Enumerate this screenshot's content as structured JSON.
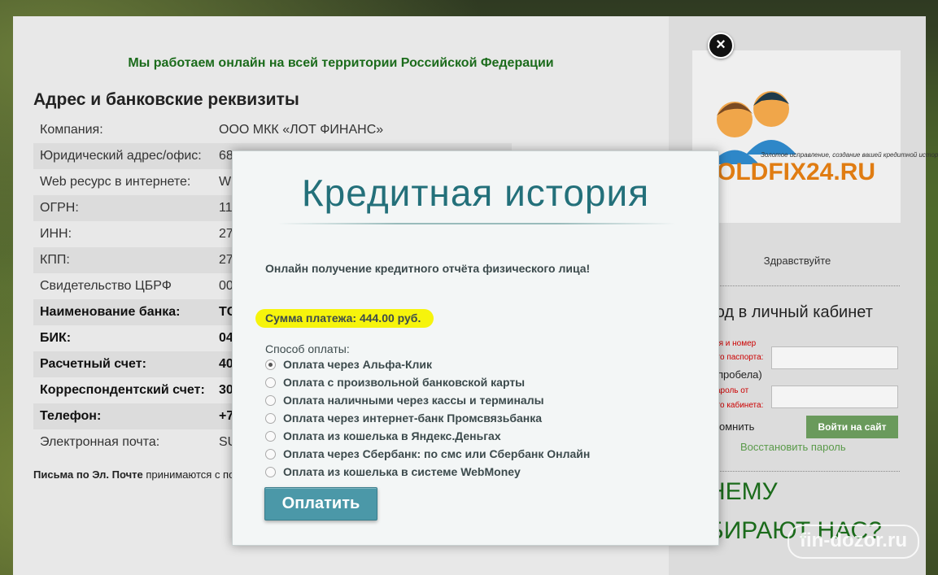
{
  "tagline": "Мы работаем онлайн на всей территории Российской Федерации",
  "section_title": "Адрес и банковские реквизиты",
  "details": [
    {
      "key": "Компания:",
      "value": "ООО МКК «ЛОТ ФИНАНС»",
      "bold": false
    },
    {
      "key": "Юридический адрес/офис:",
      "value": "68",
      "bold": false
    },
    {
      "key": "Web ресурс в интернете:",
      "value": "W",
      "bold": false
    },
    {
      "key": "ОГРН:",
      "value": "11",
      "bold": false
    },
    {
      "key": "ИНН:",
      "value": "27",
      "bold": false
    },
    {
      "key": "КПП:",
      "value": "27",
      "bold": false
    },
    {
      "key": "Свидетельство ЦБРФ",
      "value": "00",
      "bold": false
    },
    {
      "key": "Наименование банка:",
      "value": "ТС",
      "bold": true
    },
    {
      "key": "БИК:",
      "value": "04",
      "bold": true
    },
    {
      "key": "Расчетный счет:",
      "value": "40",
      "bold": true
    },
    {
      "key": "Корреспондентский счет:",
      "value": "30",
      "bold": true
    },
    {
      "key": "Телефон:",
      "value": "+7",
      "bold": true
    },
    {
      "key": "Электронная почта:",
      "value": "SU",
      "bold": false
    }
  ],
  "note": {
    "bold": "Письма по Эл. Почте",
    "text": " принимаются с по"
  },
  "sidebar": {
    "logo_text": "OLDFIX24.RU",
    "logo_small": "Золотое исправление, создание вашей кредитной истории",
    "hello": "Здравствуйте",
    "cabinet_title": "ход в личный кабинет",
    "passport_label_1": "ия и номер",
    "passport_label_2": "ого паспорта:",
    "no_space": "пробела)",
    "password_label_1": "ароль от",
    "password_label_2": "ого кабинета:",
    "remember": "омнить",
    "login_button": "Войти на сайт",
    "restore": "Восстановить пароль",
    "why_1": "НЕМУ",
    "why_2": "БИРАЮТ НАС?"
  },
  "modal": {
    "title": "Кредитная история",
    "subtitle": "Онлайн получение кредитного отчёта физического лица!",
    "sum": "Сумма платежа: 444.00 руб.",
    "pay_method_label": "Способ оплаты:",
    "options": [
      "Оплата через Альфа-Клик",
      "Оплата с произвольной банковской карты",
      "Оплата наличными через кассы и терминалы",
      "Оплата через интернет-банк Промсвязьбанка",
      "Оплата из кошелька в Яндекс.Деньгах",
      "Оплата через Сбербанк: по смс или Сбербанк Онлайн",
      "Оплата из кошелька в системе WebMoney"
    ],
    "selected_index": 0,
    "pay_button": "Оплатить",
    "close_symbol": "×"
  },
  "watermark": "fin-dozor.ru",
  "colors": {
    "accent": "#23707a",
    "highlight": "#f6f40c",
    "green": "#1b6b1b",
    "button": "#4b98a8"
  }
}
